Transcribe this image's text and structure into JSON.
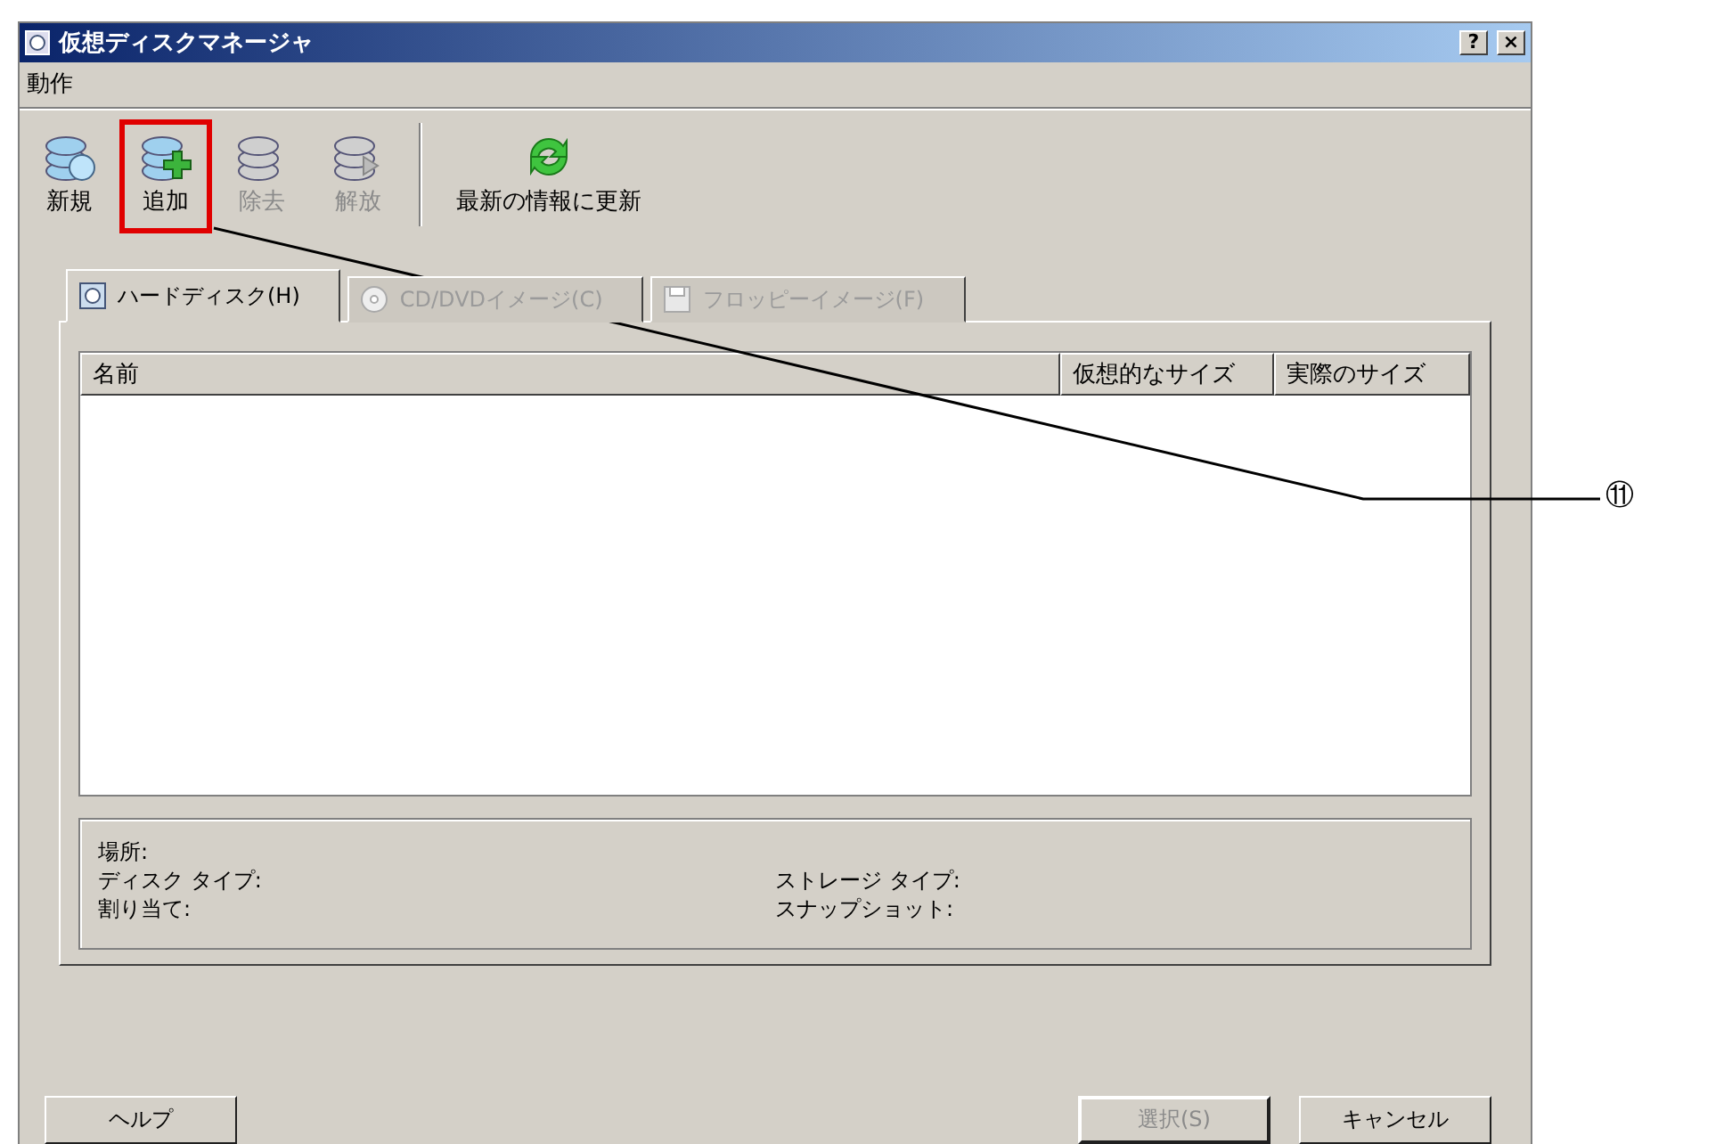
{
  "window": {
    "title": "仮想ディスクマネージャ",
    "controls": [
      "?",
      "×"
    ]
  },
  "menu": [
    "動作"
  ],
  "toolbar": [
    {
      "label": "新規",
      "kind": "new",
      "disabled": false,
      "highlighted": false
    },
    {
      "label": "追加",
      "kind": "add",
      "disabled": false,
      "highlighted": true
    },
    {
      "label": "除去",
      "kind": "remove",
      "disabled": true,
      "highlighted": false
    },
    {
      "label": "解放",
      "kind": "release",
      "disabled": true,
      "highlighted": false
    },
    {
      "label": "最新の情報に更新",
      "kind": "refresh",
      "disabled": false,
      "highlighted": false
    }
  ],
  "tabs": [
    {
      "label": "ハードディスク(H)",
      "kind": "disk",
      "selected": true,
      "disabled": false
    },
    {
      "label": "CD/DVDイメージ(C)",
      "kind": "cd",
      "selected": false,
      "disabled": true
    },
    {
      "label": "フロッピーイメージ(F)",
      "kind": "floppy",
      "selected": false,
      "disabled": true
    }
  ],
  "table": {
    "columns": [
      "名前",
      "仮想的なサイズ",
      "実際のサイズ"
    ]
  },
  "info": {
    "left": [
      "場所:",
      "ディスク タイプ:",
      "割り当て:"
    ],
    "right": [
      "ストレージ タイプ:",
      "スナップショット:"
    ]
  },
  "buttons": [
    {
      "label": "ヘルプ",
      "disabled": false,
      "default": false
    },
    {
      "label": "選択(S)",
      "disabled": true,
      "default": true
    },
    {
      "label": "キャンセル",
      "disabled": false,
      "default": false
    }
  ],
  "callout": {
    "label": "⑪"
  }
}
